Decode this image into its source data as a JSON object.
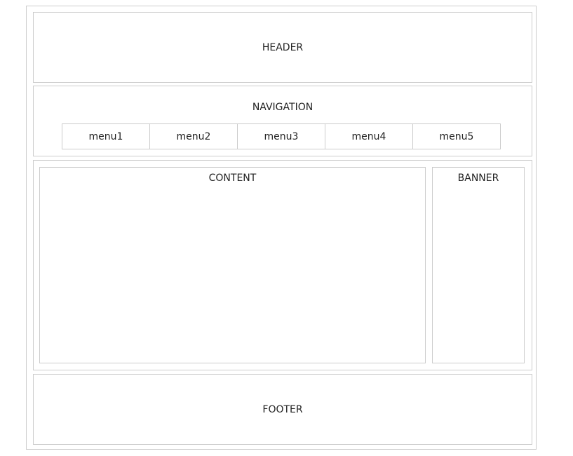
{
  "header": {
    "label": "HEADER"
  },
  "navigation": {
    "label": "NAVIGATION",
    "menu": [
      {
        "label": "menu1"
      },
      {
        "label": "menu2"
      },
      {
        "label": "menu3"
      },
      {
        "label": "menu4"
      },
      {
        "label": "menu5"
      }
    ]
  },
  "content": {
    "label": "CONTENT"
  },
  "banner": {
    "label": "BANNER"
  },
  "footer": {
    "label": "FOOTER"
  },
  "colors": {
    "border": "#cccccc",
    "text": "#222222",
    "background": "#ffffff"
  }
}
